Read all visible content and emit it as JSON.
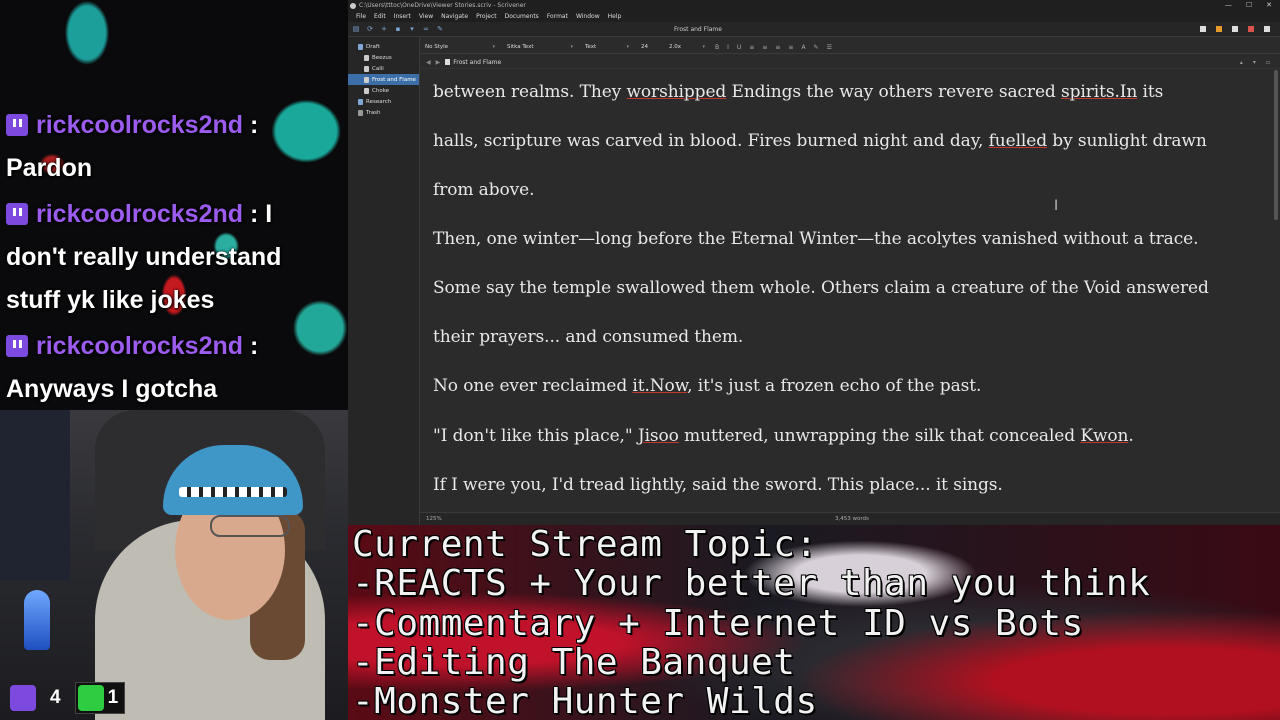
{
  "chat": {
    "messages": [
      {
        "user": "rickcoolrocks2nd",
        "separator": " :",
        "text": "Pardon"
      },
      {
        "user": "rickcoolrocks2nd",
        "separator": " : ",
        "text_inline": "I",
        "text": "don't really understand stuff yk like jokes"
      },
      {
        "user": "rickcoolrocks2nd",
        "separator": " :",
        "text": "Anyways I gotcha"
      }
    ]
  },
  "webcam": {
    "twitch_count": "4",
    "kick_count": "1"
  },
  "app": {
    "title": "C:\\Users\\tttoc\\OneDrive\\Viewer Stories.scriv - Scrivener",
    "menu": [
      "File",
      "Edit",
      "Insert",
      "View",
      "Navigate",
      "Project",
      "Documents",
      "Format",
      "Window",
      "Help"
    ],
    "document_title": "Frost and Flame",
    "binder": [
      {
        "label": "Draft",
        "level": 0,
        "icon": "folder"
      },
      {
        "label": "Beezus",
        "level": 1,
        "icon": "doc"
      },
      {
        "label": "Calli",
        "level": 1,
        "icon": "doc"
      },
      {
        "label": "Frost and Flame",
        "level": 1,
        "icon": "doc",
        "selected": true
      },
      {
        "label": "Choke",
        "level": 1,
        "icon": "doc"
      },
      {
        "label": "Research",
        "level": 0,
        "icon": "folder"
      },
      {
        "label": "Trash",
        "level": 0,
        "icon": "trash"
      }
    ],
    "format": {
      "style": "No Style",
      "font": "Sitka Text",
      "face": "Text",
      "size": "24",
      "spacing": "2.0x"
    },
    "editor_lines": [
      "between realms. They worshipped Endings the way others revere sacred spirits.In its",
      "halls, scripture was carved in blood. Fires burned night and day, fuelled by sunlight drawn",
      "from above.",
      "Then, one winter—long before the Eternal Winter—the acolytes vanished without a trace.",
      "Some say the temple swallowed them whole. Others claim a creature of the Void answered",
      "their prayers... and consumed them.",
      "No one ever reclaimed it.Now, it's just a frozen echo of the past.",
      "\"I don't like this place,\" Jisoo muttered, unwrapping the silk that concealed Kwon.",
      "If I were you, I'd tread lightly, said the sword. This place... it sings."
    ],
    "zoom": "125%",
    "word_count": "3,453 words"
  },
  "banner": {
    "lines": [
      "Current Stream Topic:",
      "-REACTS + Your better than you think",
      "-Commentary + Internet ID vs Bots",
      "-Editing The Banquet",
      "-Monster Hunter Wilds"
    ]
  }
}
